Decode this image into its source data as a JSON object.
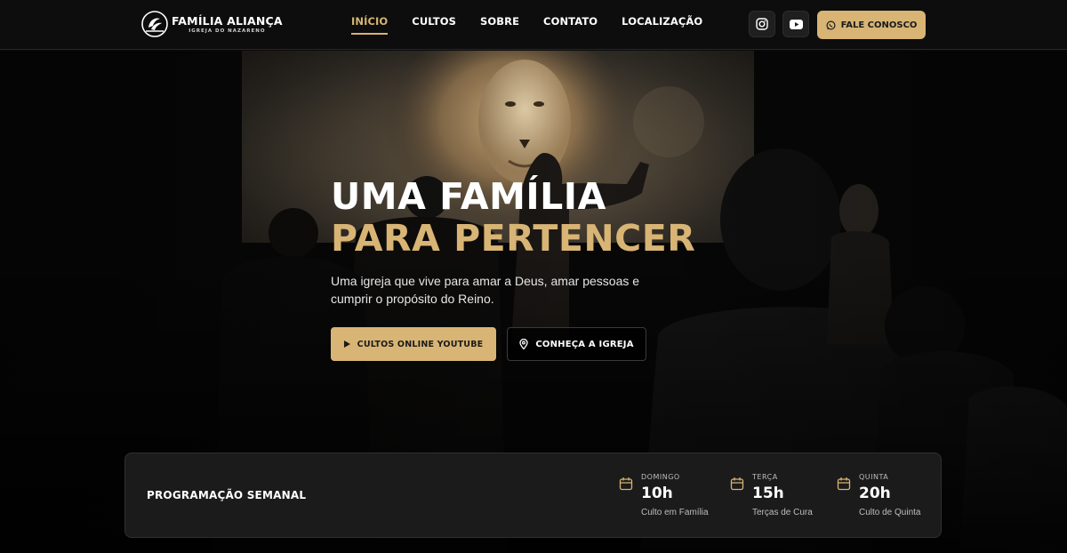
{
  "brand": {
    "name": "FAMÍLIA ALIANÇA",
    "subtitle": "IGREJA DO NAZARENO"
  },
  "nav": {
    "items": [
      {
        "label": "INÍCIO",
        "active": true
      },
      {
        "label": "CULTOS",
        "active": false
      },
      {
        "label": "SOBRE",
        "active": false
      },
      {
        "label": "CONTATO",
        "active": false
      },
      {
        "label": "LOCALIZAÇÃO",
        "active": false
      }
    ]
  },
  "header": {
    "social": [
      "instagram-icon",
      "youtube-icon"
    ],
    "cta_label": "FALE CONOSCO",
    "cta_icon": "whatsapp-icon"
  },
  "hero": {
    "title_line1": "UMA FAMÍLIA",
    "title_line2": "PARA PERTENCER",
    "subtitle": "Uma igreja que vive para amar a Deus, amar pessoas e cumprir o propósito do Reino.",
    "primary_button": "CULTOS ONLINE YOUTUBE",
    "primary_icon": "play-icon",
    "secondary_button": "CONHEÇA A IGREJA",
    "secondary_icon": "map-pin-icon"
  },
  "schedule": {
    "title": "PROGRAMAÇÃO SEMANAL",
    "slots": [
      {
        "day": "DOMINGO",
        "time": "10h",
        "desc": "Culto em Família"
      },
      {
        "day": "TERÇA",
        "time": "15h",
        "desc": "Terças de Cura"
      },
      {
        "day": "QUINTA",
        "time": "20h",
        "desc": "Culto de Quinta"
      }
    ]
  },
  "colors": {
    "accent": "#d8b475",
    "background": "#0b0b0b",
    "card": "#1b1b1b"
  }
}
